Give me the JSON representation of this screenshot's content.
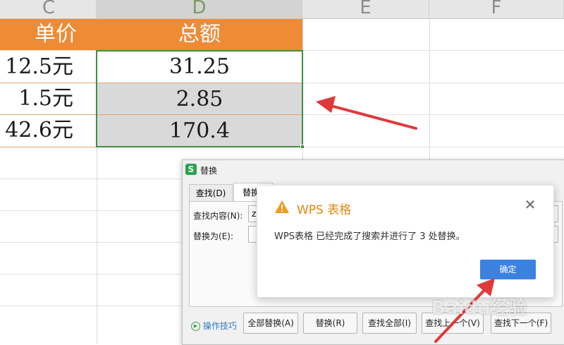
{
  "spreadsheet": {
    "columns": [
      "C",
      "D",
      "E",
      "F"
    ],
    "selected_column": "D",
    "headers": {
      "unit_price": "单价",
      "total": "总额"
    },
    "rows": [
      {
        "unit_price": "12.5元",
        "total": "31.25"
      },
      {
        "unit_price": "1.5元",
        "total": "2.85"
      },
      {
        "unit_price": "42.6元",
        "total": "170.4"
      }
    ],
    "colors": {
      "header_fill": "#ef8a35",
      "selection_border": "#3f8f3f",
      "selected_fill": "#d9d9d9",
      "annotation_arrow": "#e0393a"
    }
  },
  "replace_dialog": {
    "app_icon": "S",
    "title": "替换",
    "tabs": [
      "查找(D)",
      "替换"
    ],
    "find_label": "查找内容(N):",
    "find_value": "z",
    "replace_label": "替换为(E):",
    "replace_value": "",
    "tips_label": "操作技巧",
    "buttons": {
      "replace_all": "全部替换(A)",
      "replace": "替换(R)",
      "find_all": "查找全部(I)",
      "find_prev": "查找上一个(V)",
      "find_next": "查找下一个(F)"
    }
  },
  "message_box": {
    "icon": "warning-icon",
    "title": "WPS 表格",
    "message": "WPS表格 已经完成了搜索并进行了 3 处替换。",
    "ok_button": "确定",
    "close_icon": "close-icon"
  },
  "watermark": "Baidu经验"
}
